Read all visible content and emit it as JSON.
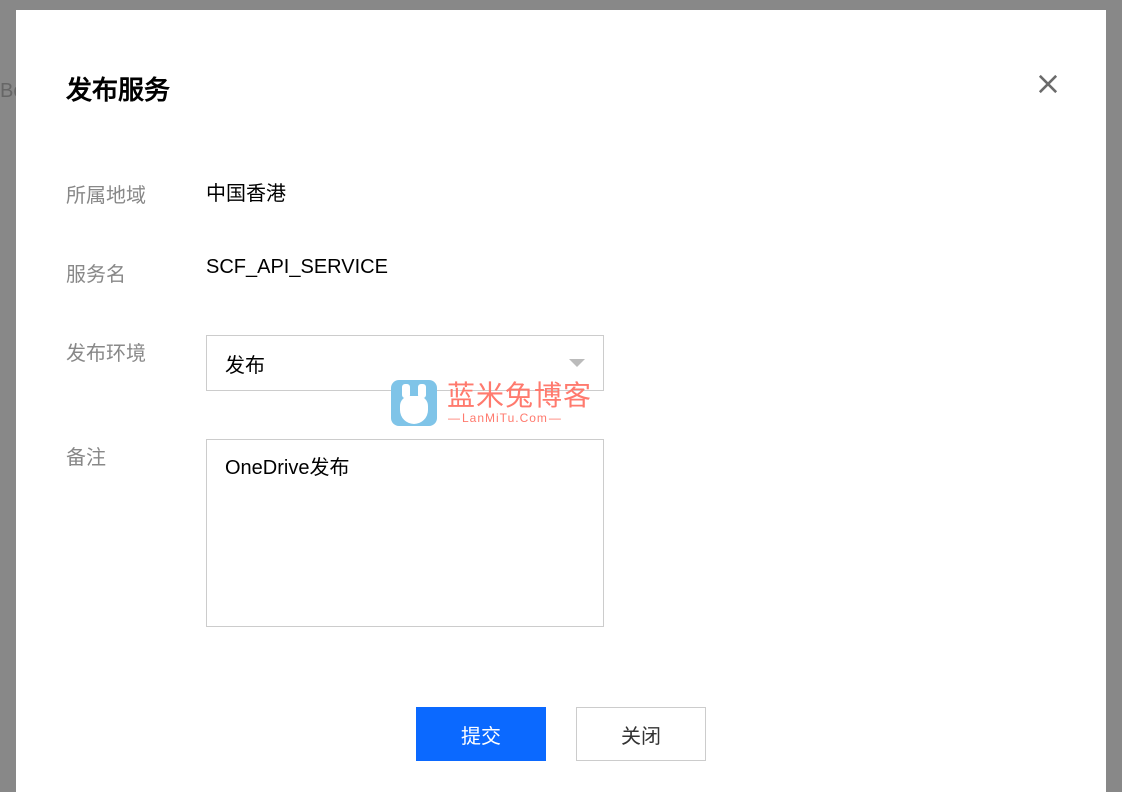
{
  "modal": {
    "title": "发布服务",
    "fields": {
      "region_label": "所属地域",
      "region_value": "中国香港",
      "service_label": "服务名",
      "service_value": "SCF_API_SERVICE",
      "env_label": "发布环境",
      "env_value": "发布",
      "note_label": "备注",
      "note_value": "OneDrive发布"
    },
    "buttons": {
      "submit": "提交",
      "close": "关闭"
    }
  },
  "watermark": {
    "cn": "蓝米兔博客",
    "en": "LanMiTu.Com"
  },
  "background_fragment": "Bo"
}
